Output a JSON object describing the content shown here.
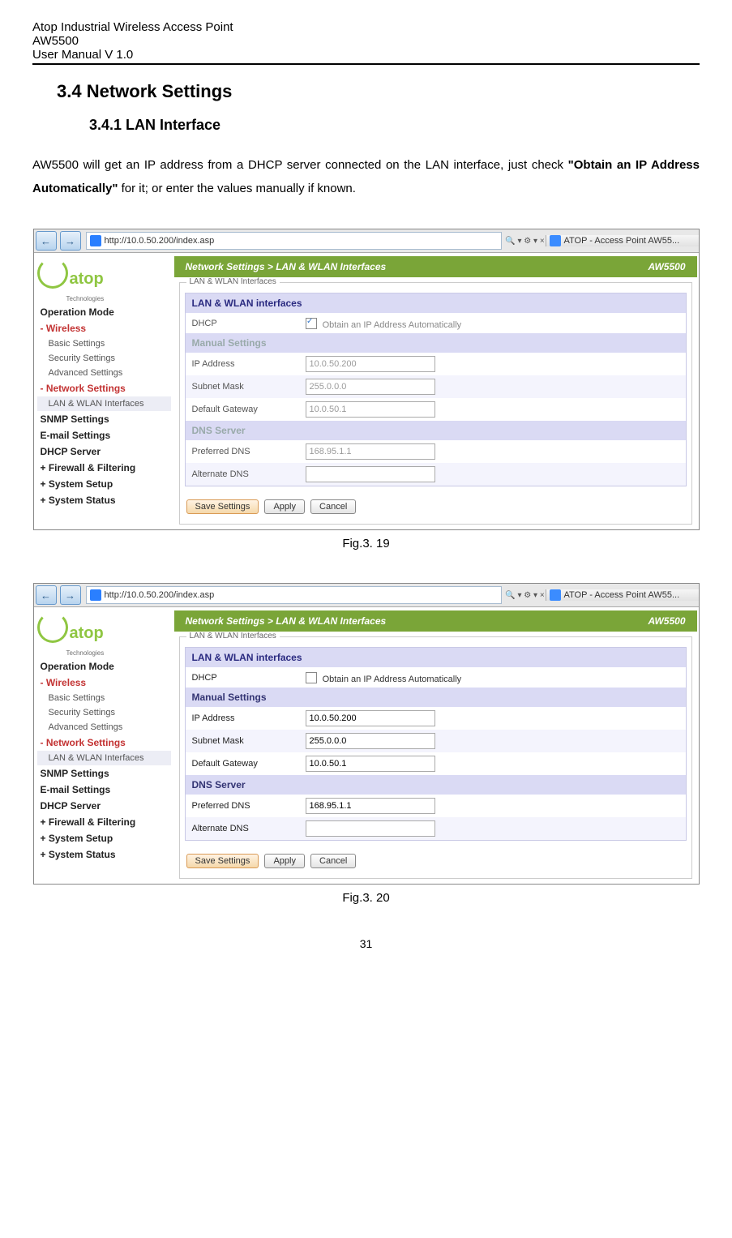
{
  "doc_header": {
    "line1": "Atop Industrial Wireless Access Point",
    "line2": "AW5500",
    "line3": "User Manual V 1.0"
  },
  "section_heading": "3.4  Network Settings",
  "subsection_heading": "3.4.1 LAN Interface",
  "paragraph_parts": {
    "p1": "AW5500 will get an IP address from a DHCP server connected on the LAN interface, just check ",
    "p2": "\"Obtain an IP Address Automatically\"",
    "p3": " for it; or enter the values manually if known."
  },
  "addrbar": {
    "url": "http://10.0.50.200/index.asp",
    "search_hint": "🔍 ▾   ⚙ ▾ ×",
    "tab_title": "ATOP - Access Point AW55..."
  },
  "logo": {
    "text": "atop",
    "sub": "Technologies"
  },
  "nav": {
    "op_mode": "Operation Mode",
    "wireless": "- Wireless",
    "basic": "Basic Settings",
    "security": "Security Settings",
    "advanced": "Advanced Settings",
    "netset": "- Network Settings",
    "lanwlan": "LAN & WLAN Interfaces",
    "snmp": "SNMP Settings",
    "email": "E-mail Settings",
    "dhcp": "DHCP Server",
    "firewall": "+ Firewall & Filtering",
    "syssetup": "+ System Setup",
    "sysstatus": "+ System Status"
  },
  "content": {
    "breadcrumb": "Network Settings > LAN & WLAN Interfaces",
    "model": "AW5500",
    "fieldset_title": "LAN & WLAN Interfaces",
    "sect_lanwlan": "LAN & WLAN interfaces",
    "dhcp_label": "DHCP",
    "dhcp_text": "Obtain an IP Address Automatically",
    "sect_manual": "Manual Settings",
    "ip_label": "IP Address",
    "ip_value": "10.0.50.200",
    "subnet_label": "Subnet Mask",
    "subnet_value": "255.0.0.0",
    "gw_label": "Default Gateway",
    "gw_value": "10.0.50.1",
    "sect_dns": "DNS Server",
    "pdns_label": "Preferred DNS",
    "pdns_value": "168.95.1.1",
    "adns_label": "Alternate DNS",
    "adns_value": "",
    "btn_save": "Save Settings",
    "btn_apply": "Apply",
    "btn_cancel": "Cancel"
  },
  "fig19_caption": "Fig.3. 19",
  "fig20_caption": "Fig.3. 20",
  "page_number": "31"
}
